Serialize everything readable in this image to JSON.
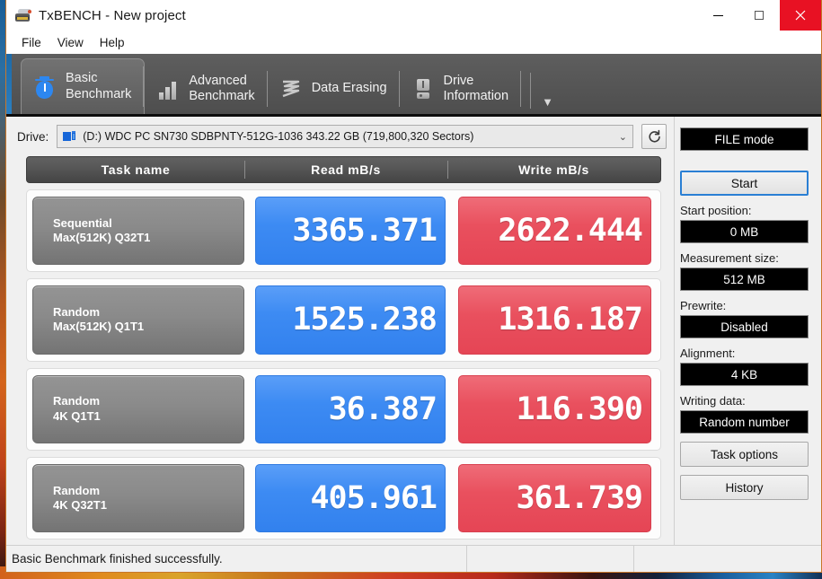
{
  "window": {
    "title": "TxBENCH - New project",
    "app_icon": "scanner-icon",
    "controls": {
      "minimize": "minimize-icon",
      "maximize": "maximize-icon",
      "close": "close-icon",
      "close_color": "#e81123"
    }
  },
  "menubar": {
    "items": [
      {
        "label": "File"
      },
      {
        "label": "View"
      },
      {
        "label": "Help"
      }
    ]
  },
  "tabs": {
    "overflow_glyph": "▼",
    "items": [
      {
        "label": "Basic\nBenchmark",
        "icon": "stopwatch-icon",
        "active": true
      },
      {
        "label": "Advanced\nBenchmark",
        "icon": "bar-chart-icon",
        "active": false
      },
      {
        "label": "Data Erasing",
        "icon": "zigzag-erase-icon",
        "active": false
      },
      {
        "label": "Drive\nInformation",
        "icon": "drive-info-icon",
        "active": false
      }
    ]
  },
  "drive": {
    "label": "Drive:",
    "icon": "disk-drive-icon",
    "value": "(D:) WDC PC SN730 SDBPNTY-512G-1036  343.22 GB (719,800,320 Sectors)",
    "caret": "⌄",
    "refresh_icon": "refresh-icon"
  },
  "table": {
    "headers": {
      "task": "Task name",
      "read": "Read mB/s",
      "write": "Write mB/s"
    },
    "rows": [
      {
        "name_line1": "Sequential",
        "name_line2": "Max(512K) Q32T1",
        "read": "3365.371",
        "write": "2622.444"
      },
      {
        "name_line1": "Random",
        "name_line2": "Max(512K) Q1T1",
        "read": "1525.238",
        "write": "1316.187"
      },
      {
        "name_line1": "Random",
        "name_line2": "4K Q1T1",
        "read": "36.387",
        "write": "116.390"
      },
      {
        "name_line1": "Random",
        "name_line2": "4K Q32T1",
        "read": "405.961",
        "write": "361.739"
      }
    ],
    "read_color": "#3d8bf3",
    "write_color": "#e9505e"
  },
  "panel": {
    "mode": "FILE mode",
    "start_button": "Start",
    "start_position_label": "Start position:",
    "start_position_value": "0 MB",
    "measurement_size_label": "Measurement size:",
    "measurement_size_value": "512 MB",
    "prewrite_label": "Prewrite:",
    "prewrite_value": "Disabled",
    "alignment_label": "Alignment:",
    "alignment_value": "4 KB",
    "writing_data_label": "Writing data:",
    "writing_data_value": "Random number",
    "task_options_button": "Task options",
    "history_button": "History"
  },
  "statusbar": {
    "message": "Basic Benchmark finished successfully.",
    "pane2": "",
    "pane3": ""
  }
}
